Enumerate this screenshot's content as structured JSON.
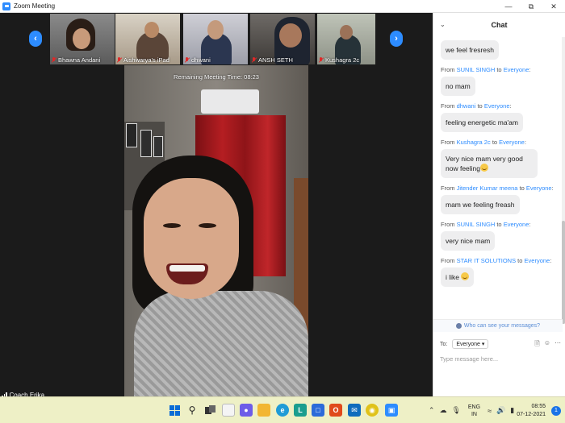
{
  "window": {
    "title": "Zoom Meeting",
    "minimize": "—",
    "maximize": "⧉",
    "close": "✕"
  },
  "gallery": {
    "prev": "‹",
    "next": "›",
    "participants": [
      {
        "name": "Bhawna Andani"
      },
      {
        "name": "Aishwarya's iPad"
      },
      {
        "name": "dhwani"
      },
      {
        "name": "ANSH SETH"
      },
      {
        "name": "Kushagra 2c"
      }
    ]
  },
  "main_video": {
    "timer": "Remaining Meeting Time: 08:23",
    "self_name": "Coach Erika"
  },
  "chat": {
    "title": "Chat",
    "messages": [
      {
        "from": "",
        "to": "",
        "text": "we feel fresresh"
      },
      {
        "from": "SUNIL SINGH",
        "to": "Everyone",
        "text": "no mam"
      },
      {
        "from": "dhwani",
        "to": "Everyone",
        "text": "feeling energetic ma'am"
      },
      {
        "from": "Kushagra 2c",
        "to": "Everyone",
        "text": "Very nice mam very good now feeling",
        "emoji": true
      },
      {
        "from": "Jitender Kumar meena",
        "to": "Everyone",
        "text": "mam we feeling freash"
      },
      {
        "from": "SUNIL SINGH",
        "to": "Everyone",
        "text": "very nice mam"
      },
      {
        "from": "STAR IT SOLUTIONS",
        "to": "Everyone",
        "text": "i like",
        "emoji": true
      }
    ],
    "from_word": "From",
    "to_word": "to",
    "who_can_see": "Who can see your messages?",
    "to_label": "To:",
    "recipient": "Everyone",
    "input_placeholder": "Type message here..."
  },
  "taskbar": {
    "lang_top": "ENG",
    "lang_bottom": "IN",
    "time": "08:55",
    "date": "07-12-2021",
    "notification_count": "1"
  }
}
